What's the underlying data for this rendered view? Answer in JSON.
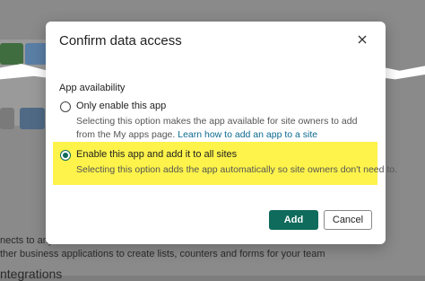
{
  "background": {
    "text_line_1": "nects to any",
    "text_line_2": "ther business applications to create lists, counters and forms for your team",
    "text_line_3": "ntegrations"
  },
  "dialog": {
    "title": "Confirm data access",
    "close_icon": "close-icon",
    "section_label": "App availability",
    "options": [
      {
        "label": "Only enable this app",
        "description": "Selecting this option makes the app available for site owners to add from the My apps page.",
        "link_text": "Learn how to add an app to a site",
        "selected": false
      },
      {
        "label": "Enable this app and add it to all sites",
        "description": "Selecting this option adds the app automatically so site owners don't need to.",
        "selected": true,
        "highlighted": true
      }
    ],
    "buttons": {
      "add": "Add",
      "cancel": "Cancel"
    }
  },
  "colors": {
    "accent": "#0f6b5c",
    "link": "#0b6a8f",
    "highlight": "#fdf34a"
  }
}
